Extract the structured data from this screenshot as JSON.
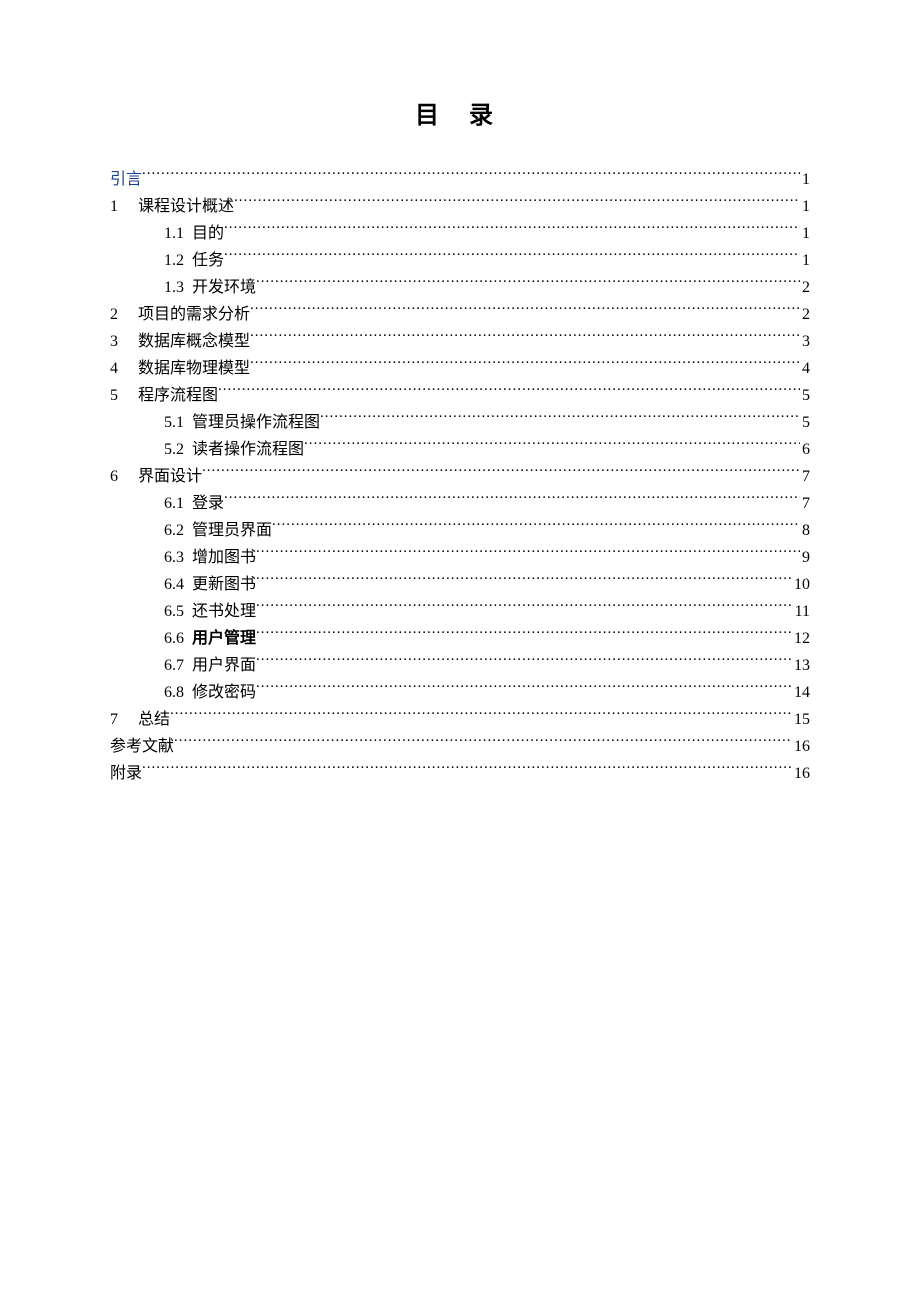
{
  "title": "目 录",
  "entries": [
    {
      "num": "",
      "label": "引言",
      "page": "1",
      "indent": 0,
      "link": true,
      "bold": false
    },
    {
      "num": "1",
      "label": "课程设计概述",
      "page": "1",
      "indent": 0,
      "link": false,
      "bold": false
    },
    {
      "num": "1.1",
      "label": "目的",
      "page": "1",
      "indent": 1,
      "link": false,
      "bold": false
    },
    {
      "num": "1.2",
      "label": "任务",
      "page": "1",
      "indent": 1,
      "link": false,
      "bold": false
    },
    {
      "num": "1.3",
      "label": "开发环境",
      "page": "2",
      "indent": 1,
      "link": false,
      "bold": false
    },
    {
      "num": "2",
      "label": "项目的需求分析",
      "page": "2",
      "indent": 0,
      "link": false,
      "bold": false
    },
    {
      "num": "3",
      "label": "数据库概念模型",
      "page": "3",
      "indent": 0,
      "link": false,
      "bold": false
    },
    {
      "num": "4",
      "label": "数据库物理模型",
      "page": "4",
      "indent": 0,
      "link": false,
      "bold": false
    },
    {
      "num": "5",
      "label": "程序流程图",
      "page": "5",
      "indent": 0,
      "link": false,
      "bold": false
    },
    {
      "num": "5.1",
      "label": "管理员操作流程图",
      "page": "5",
      "indent": 1,
      "link": false,
      "bold": false
    },
    {
      "num": "5.2",
      "label": "读者操作流程图",
      "page": "6",
      "indent": 1,
      "link": false,
      "bold": false
    },
    {
      "num": "6",
      "label": "界面设计",
      "page": "7",
      "indent": 0,
      "link": false,
      "bold": false
    },
    {
      "num": "6.1",
      "label": "登录",
      "page": "7",
      "indent": 1,
      "link": false,
      "bold": false
    },
    {
      "num": "6.2",
      "label": "管理员界面",
      "page": "8",
      "indent": 1,
      "link": false,
      "bold": false
    },
    {
      "num": "6.3",
      "label": "增加图书",
      "page": "9",
      "indent": 1,
      "link": false,
      "bold": false
    },
    {
      "num": "6.4",
      "label": "更新图书",
      "page": "10",
      "indent": 1,
      "link": false,
      "bold": false
    },
    {
      "num": "6.5",
      "label": "还书处理",
      "page": "11",
      "indent": 1,
      "link": false,
      "bold": false
    },
    {
      "num": "6.6",
      "label": "用户管理",
      "page": "12",
      "indent": 1,
      "link": false,
      "bold": true
    },
    {
      "num": "6.7",
      "label": "用户界面",
      "page": "13",
      "indent": 1,
      "link": false,
      "bold": false
    },
    {
      "num": "6.8",
      "label": "修改密码",
      "page": "14",
      "indent": 1,
      "link": false,
      "bold": false
    },
    {
      "num": "7",
      "label": "总结",
      "page": "15",
      "indent": 0,
      "link": false,
      "bold": false
    },
    {
      "num": "",
      "label": "参考文献",
      "page": "16",
      "indent": 0,
      "link": false,
      "bold": false
    },
    {
      "num": "",
      "label": "附录",
      "page": "16",
      "indent": 0,
      "link": false,
      "bold": false
    }
  ]
}
